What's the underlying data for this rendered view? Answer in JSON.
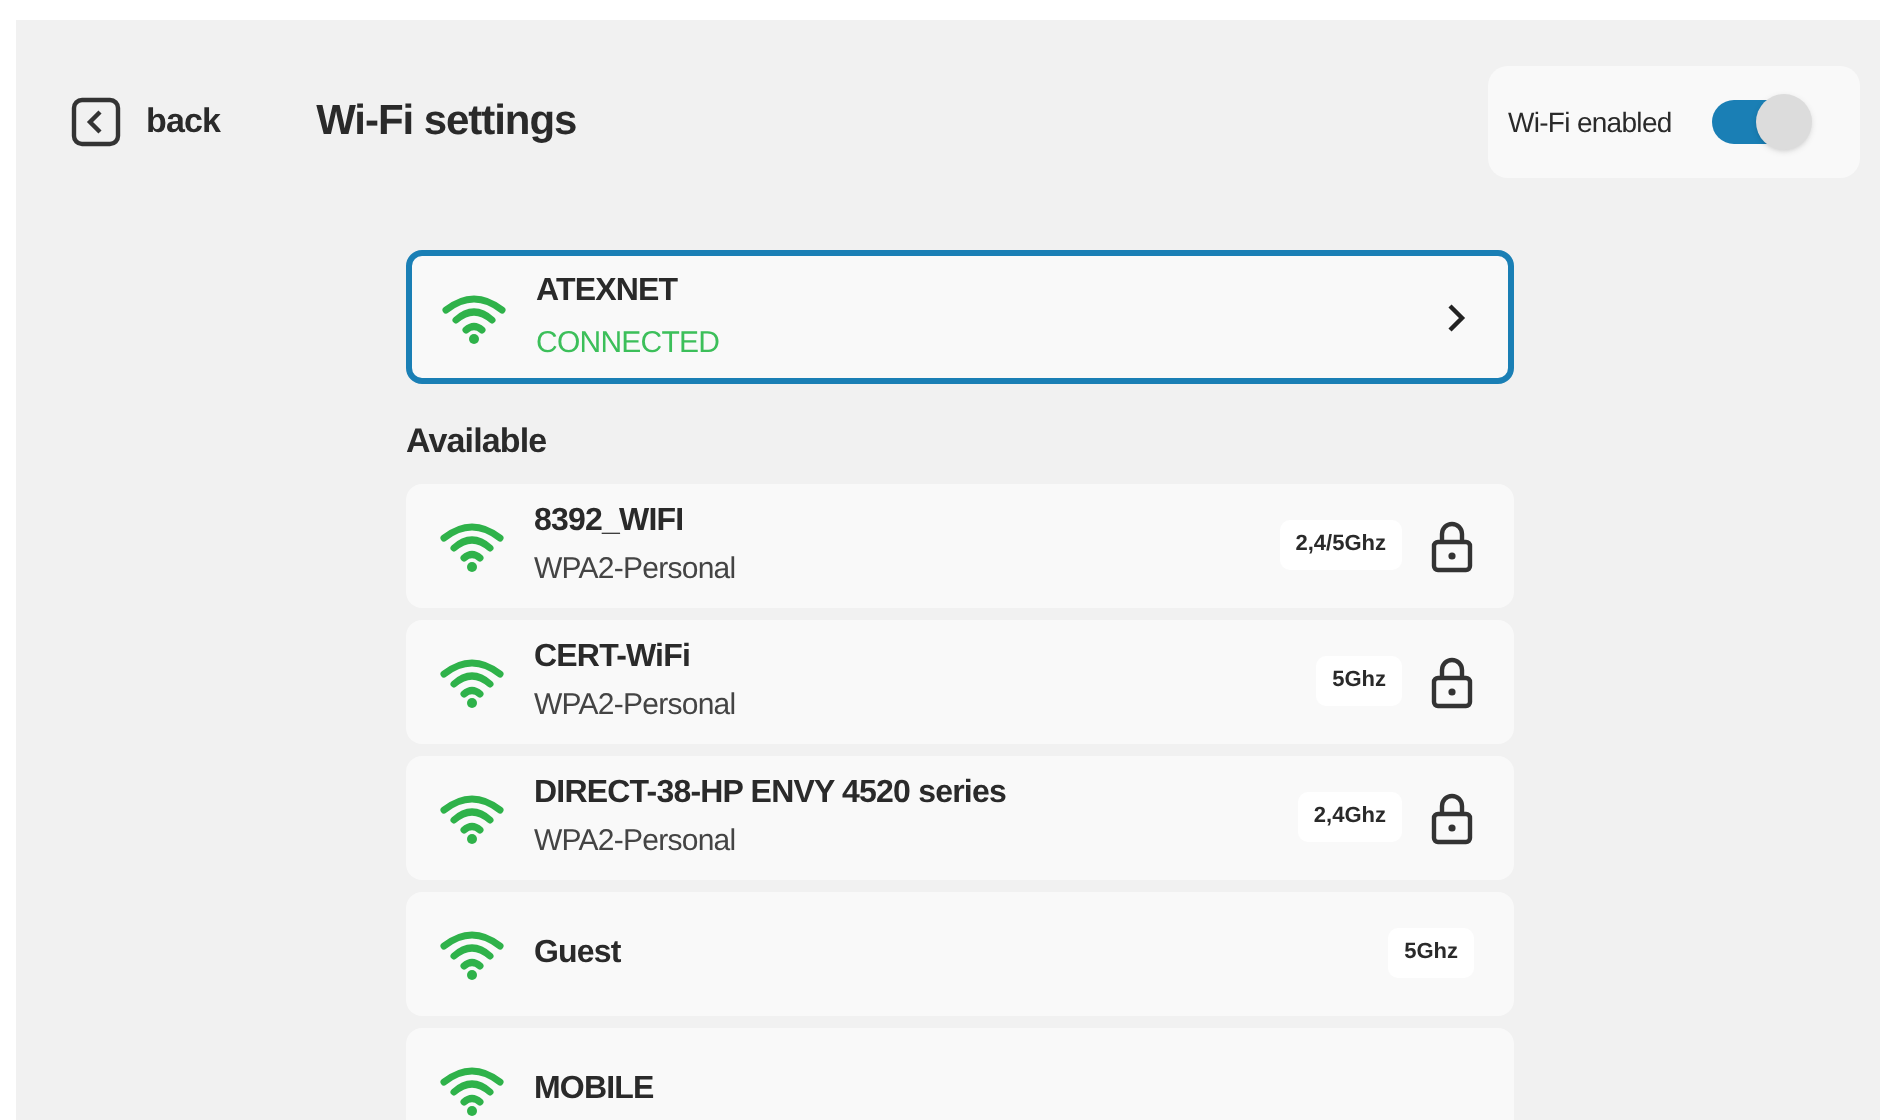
{
  "header": {
    "back": "back",
    "title": "Wi-Fi settings",
    "toggle": {
      "label": "Wi-Fi enabled",
      "on": true
    }
  },
  "connected": {
    "name": "ATEXNET",
    "status": "CONNECTED"
  },
  "available": {
    "heading": "Available",
    "networks": [
      {
        "name": "8392_WIFI",
        "security": "WPA2-Personal",
        "band": "2,4/5Ghz",
        "locked": true
      },
      {
        "name": "CERT-WiFi",
        "security": "WPA2-Personal",
        "band": "5Ghz",
        "locked": true
      },
      {
        "name": "DIRECT-38-HP ENVY 4520 series",
        "security": "WPA2-Personal",
        "band": "2,4Ghz",
        "locked": true
      },
      {
        "name": "Guest",
        "band": "5Ghz",
        "locked": false
      },
      {
        "name": "MOBILE"
      }
    ]
  }
}
